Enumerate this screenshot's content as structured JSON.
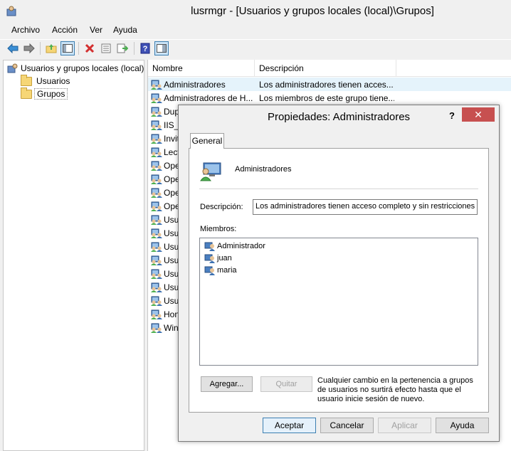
{
  "window": {
    "title": "lusrmgr - [Usuarios y grupos locales (local)\\Grupos]"
  },
  "menu": [
    "Archivo",
    "Acción",
    "Ver",
    "Ayuda"
  ],
  "toolbar_icons": [
    "back-arrow-icon",
    "forward-arrow-icon",
    "up-folder-icon",
    "show-tree-icon",
    "delete-icon",
    "properties-icon",
    "export-list-icon",
    "help-icon",
    "show-action-pane-icon"
  ],
  "tree": {
    "root": "Usuarios y grupos locales (local)",
    "children": [
      "Usuarios",
      "Grupos"
    ],
    "selected": "Grupos"
  },
  "list": {
    "columns": [
      "Nombre",
      "Descripción"
    ],
    "rows": [
      {
        "name": "Administradores",
        "desc": "Los administradores tienen acces..."
      },
      {
        "name": "Administradores de H...",
        "desc": "Los miembros de este grupo tiene..."
      },
      {
        "name": "Dup",
        "desc": ""
      },
      {
        "name": "IIS_I",
        "desc": ""
      },
      {
        "name": "Invit",
        "desc": ""
      },
      {
        "name": "Lect",
        "desc": ""
      },
      {
        "name": "Ope",
        "desc": ""
      },
      {
        "name": "Ope",
        "desc": ""
      },
      {
        "name": "Ope",
        "desc": ""
      },
      {
        "name": "Ope",
        "desc": ""
      },
      {
        "name": "Usua",
        "desc": ""
      },
      {
        "name": "Usua",
        "desc": ""
      },
      {
        "name": "Usua",
        "desc": ""
      },
      {
        "name": "Usua",
        "desc": ""
      },
      {
        "name": "Usua",
        "desc": ""
      },
      {
        "name": "Usua",
        "desc": ""
      },
      {
        "name": "Usua",
        "desc": ""
      },
      {
        "name": "Hon",
        "desc": ""
      },
      {
        "name": "Win",
        "desc": ""
      }
    ]
  },
  "dialog": {
    "title": "Propiedades: Administradores",
    "help": "?",
    "close": "✕",
    "tab": "General",
    "group_name": "Administradores",
    "desc_label": "Descripción:",
    "desc_value": "Los administradores tienen acceso completo y sin restricciones al",
    "members_label": "Miembros:",
    "members": [
      "Administrador",
      "juan",
      "maria"
    ],
    "add_button": "Agregar...",
    "remove_button": "Quitar",
    "note": "Cualquier cambio en la pertenencia a grupos de usuarios no surtirá efecto hasta que el usuario inicie sesión de nuevo.",
    "ok_button": "Aceptar",
    "cancel_button": "Cancelar",
    "apply_button": "Aplicar",
    "help_button": "Ayuda"
  }
}
